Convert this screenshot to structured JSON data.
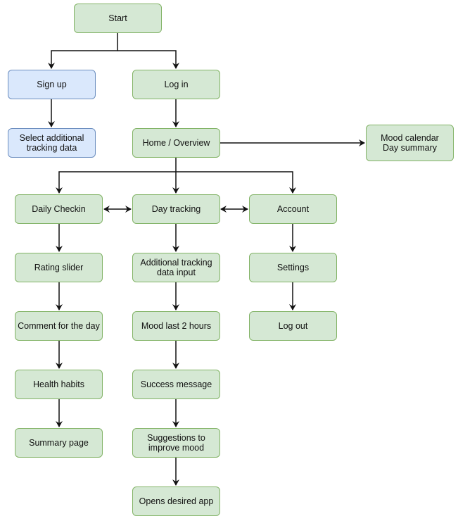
{
  "diagram": {
    "colors": {
      "green_fill": "#d5e8d4",
      "green_stroke": "#82b366",
      "blue_fill": "#dae8fc",
      "blue_stroke": "#6c8ebf",
      "edge": "#111111"
    },
    "nodes": {
      "start": "Start",
      "signup": "Sign up",
      "login": "Log in",
      "select_tracking": "Select additional\ntracking data",
      "home": "Home / Overview",
      "mood_calendar": "Mood calendar\nDay summary",
      "daily_checkin": "Daily Checkin",
      "day_tracking": "Day tracking",
      "account": "Account",
      "rating_slider": "Rating slider",
      "additional_input": "Additional tracking\ndata input",
      "settings": "Settings",
      "comment": "Comment for the day",
      "mood_last": "Mood last 2 hours",
      "logout": "Log out",
      "health_habits": "Health habits",
      "success": "Success message",
      "summary": "Summary page",
      "suggestions": "Suggestions to\nimprove mood",
      "opens_app": "Opens desired app"
    },
    "edges": [
      {
        "from": "start",
        "to": "signup",
        "type": "arrow"
      },
      {
        "from": "start",
        "to": "login",
        "type": "arrow"
      },
      {
        "from": "signup",
        "to": "select_tracking",
        "type": "arrow"
      },
      {
        "from": "login",
        "to": "home",
        "type": "arrow"
      },
      {
        "from": "home",
        "to": "mood_calendar",
        "type": "arrow"
      },
      {
        "from": "home",
        "to": "daily_checkin",
        "type": "arrow"
      },
      {
        "from": "home",
        "to": "day_tracking",
        "type": "arrow"
      },
      {
        "from": "home",
        "to": "account",
        "type": "arrow"
      },
      {
        "from": "daily_checkin",
        "to": "day_tracking",
        "type": "bidirectional"
      },
      {
        "from": "day_tracking",
        "to": "account",
        "type": "bidirectional"
      },
      {
        "from": "daily_checkin",
        "to": "rating_slider",
        "type": "arrow"
      },
      {
        "from": "rating_slider",
        "to": "comment",
        "type": "arrow"
      },
      {
        "from": "comment",
        "to": "health_habits",
        "type": "arrow"
      },
      {
        "from": "health_habits",
        "to": "summary",
        "type": "arrow"
      },
      {
        "from": "day_tracking",
        "to": "additional_input",
        "type": "arrow"
      },
      {
        "from": "additional_input",
        "to": "mood_last",
        "type": "arrow"
      },
      {
        "from": "mood_last",
        "to": "success",
        "type": "arrow"
      },
      {
        "from": "success",
        "to": "suggestions",
        "type": "arrow"
      },
      {
        "from": "suggestions",
        "to": "opens_app",
        "type": "arrow"
      },
      {
        "from": "account",
        "to": "settings",
        "type": "arrow"
      },
      {
        "from": "settings",
        "to": "logout",
        "type": "arrow"
      }
    ]
  }
}
